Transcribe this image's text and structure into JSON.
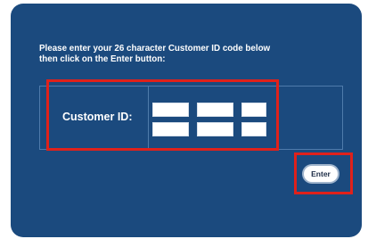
{
  "instructions": {
    "line1": "Please enter your 26 character Customer ID code below",
    "line2": "then click on the Enter button:"
  },
  "form": {
    "label": "Customer ID:",
    "fields": [
      "",
      "",
      "",
      "",
      "",
      ""
    ]
  },
  "enter_button": {
    "label": "Enter"
  },
  "colors": {
    "panel_background": "#1b4a7e",
    "highlight": "#e0211b",
    "text": "#ffffff"
  }
}
